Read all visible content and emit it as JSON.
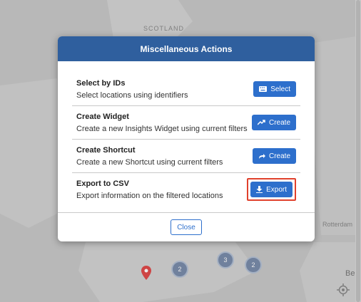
{
  "map": {
    "labels": {
      "scotland": "SCOTLAND",
      "rotterdam": "Rotterdam",
      "be": "Be"
    },
    "clusters": [
      "2",
      "3",
      "2"
    ]
  },
  "modal": {
    "title": "Miscellaneous Actions",
    "actions": [
      {
        "title": "Select by IDs",
        "description": "Select locations using identifiers",
        "button_label": "Select",
        "icon": "keyboard-icon"
      },
      {
        "title": "Create Widget",
        "description": "Create a new Insights Widget using current filters",
        "button_label": "Create",
        "icon": "trend-icon"
      },
      {
        "title": "Create Shortcut",
        "description": "Create a new Shortcut using current filters",
        "button_label": "Create",
        "icon": "share-arrow-icon"
      },
      {
        "title": "Export to CSV",
        "description": "Export information on the filtered locations",
        "button_label": "Export",
        "icon": "download-icon"
      }
    ],
    "close_label": "Close"
  },
  "colors": {
    "header": "#2f5f9e",
    "button": "#2d6fcc",
    "highlight": "#e0402c"
  }
}
